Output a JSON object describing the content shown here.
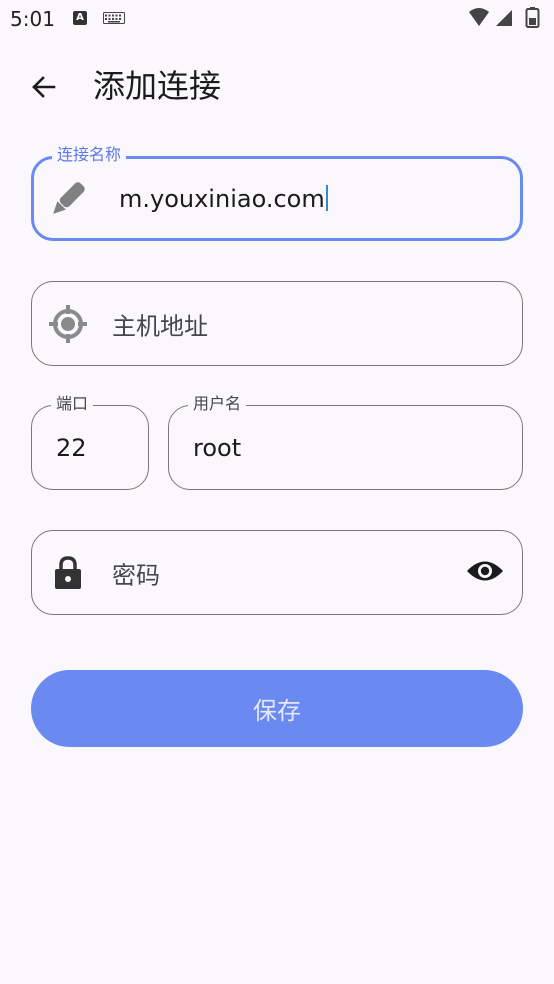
{
  "status_bar": {
    "time": "5:01",
    "notification_letter": "A",
    "icons": [
      "keyboard-icon",
      "wifi-icon",
      "signal-icon",
      "battery-icon"
    ]
  },
  "app_bar": {
    "title": "添加连接",
    "back_icon": "arrow-back-icon"
  },
  "form": {
    "connection_name": {
      "label": "连接名称",
      "value": "m.youxiniao.com",
      "icon": "pencil-icon"
    },
    "host": {
      "placeholder": "主机地址",
      "icon": "target-icon"
    },
    "port": {
      "label": "端口",
      "value": "22"
    },
    "username": {
      "label": "用户名",
      "value": "root"
    },
    "password": {
      "placeholder": "密码",
      "icon": "lock-icon",
      "toggle_icon": "eye-icon"
    }
  },
  "actions": {
    "save_label": "保存"
  },
  "colors": {
    "primary": "#6a8af2",
    "background": "#fbf8fd",
    "outline": "#79767f",
    "focused_label": "#5b78e6"
  }
}
